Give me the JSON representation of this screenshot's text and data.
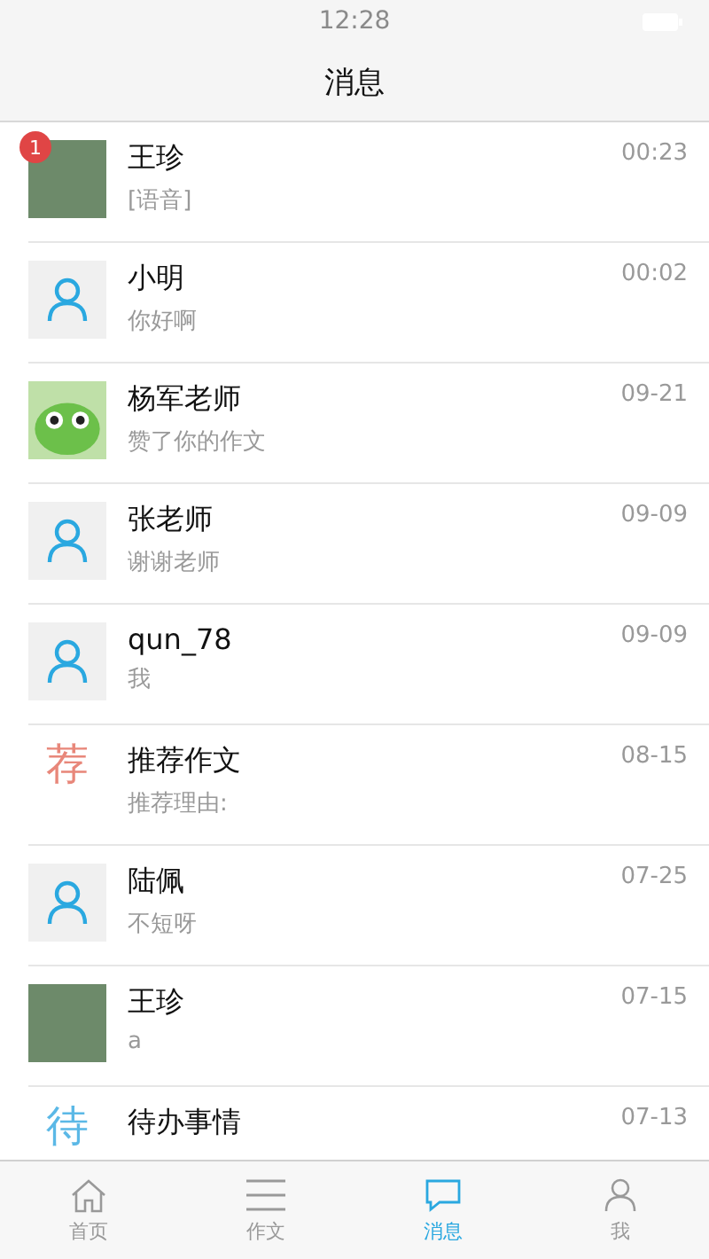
{
  "status_bar": {
    "time": "12:28"
  },
  "nav": {
    "title": "消息"
  },
  "messages": [
    {
      "name": "王珍",
      "preview": "[语音]",
      "time": "00:23",
      "avatar": {
        "kind": "photo"
      },
      "badge": "1"
    },
    {
      "name": "小明",
      "preview": "你好啊",
      "time": "00:02",
      "avatar": {
        "kind": "person"
      }
    },
    {
      "name": "杨军老师",
      "preview": "赞了你的作文",
      "time": "09-21",
      "avatar": {
        "kind": "cartoon"
      }
    },
    {
      "name": "张老师",
      "preview": "谢谢老师",
      "time": "09-09",
      "avatar": {
        "kind": "person"
      }
    },
    {
      "name": "qun_78",
      "preview": "我",
      "time": "09-09",
      "avatar": {
        "kind": "person"
      }
    },
    {
      "name": "推荐作文",
      "preview": "推荐理由:",
      "time": "08-15",
      "avatar": {
        "kind": "glyph",
        "text": "荐",
        "color": "#e8877a"
      }
    },
    {
      "name": "陆佩",
      "preview": "不短呀",
      "time": "07-25",
      "avatar": {
        "kind": "person"
      }
    },
    {
      "name": "王珍",
      "preview": "a",
      "time": "07-15",
      "avatar": {
        "kind": "photo"
      }
    },
    {
      "name": "待办事情",
      "time": "07-13",
      "avatar": {
        "kind": "glyph",
        "text": "待",
        "color": "#5bb8e6"
      }
    }
  ],
  "tab_bar": [
    {
      "label": "首页",
      "selected": false
    },
    {
      "label": "作文",
      "selected": false
    },
    {
      "label": "消息",
      "selected": true
    },
    {
      "label": "我",
      "selected": false
    }
  ]
}
